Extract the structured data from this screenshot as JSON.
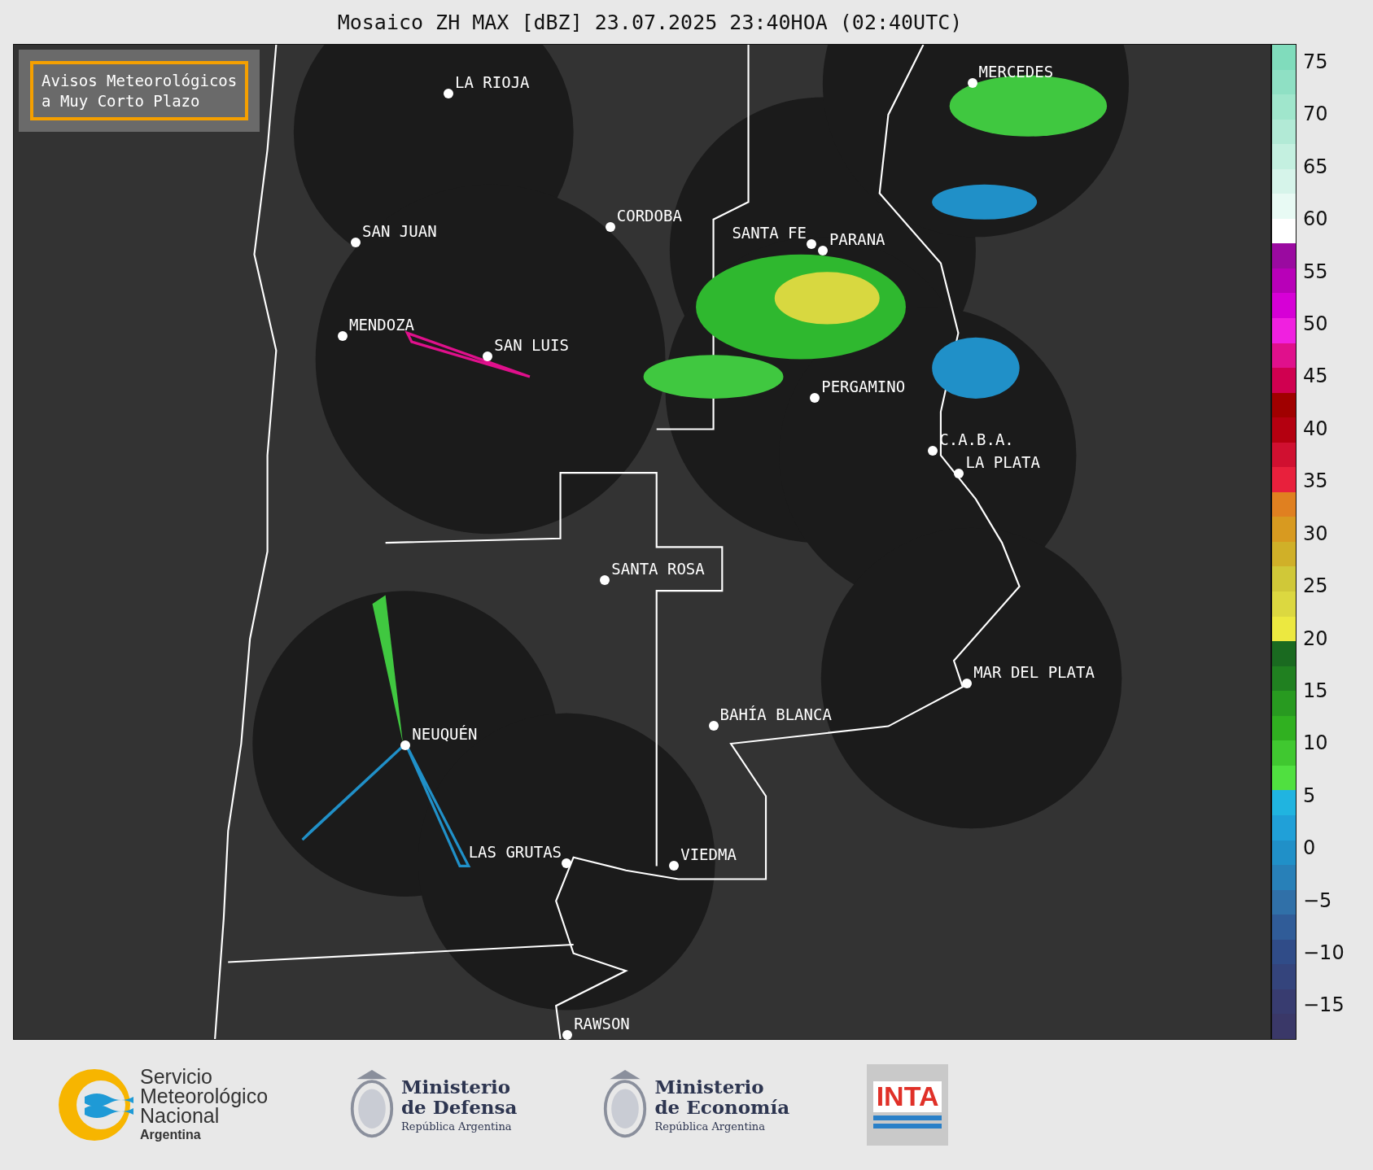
{
  "title": "Mosaico ZH MAX [dBZ] 23.07.2025 23:40HOA (02:40UTC)",
  "notice": "Avisos Meteorológicos\na Muy Corto Plazo",
  "cities": [
    "LA RIOJA",
    "SAN JUAN",
    "CORDOBA",
    "SANTA FE",
    "PARANA",
    "MENDOZA",
    "SAN LUIS",
    "MERCEDES",
    "PERGAMINO",
    "C.A.B.A.",
    "LA PLATA",
    "SANTA ROSA",
    "MAR DEL PLATA",
    "BAHÍA BLANCA",
    "NEUQUÉN",
    "LAS GRUTAS",
    "VIEDMA",
    "RAWSON"
  ],
  "colorbar": {
    "ticks": [
      "75",
      "70",
      "65",
      "60",
      "55",
      "50",
      "45",
      "40",
      "35",
      "30",
      "25",
      "20",
      "15",
      "10",
      "5",
      "0",
      "−5",
      "−10",
      "−15"
    ]
  },
  "logos": [
    {
      "kind": "smn",
      "lines": [
        "Servicio",
        "Meteorológico",
        "Nacional"
      ],
      "sub": "Argentina"
    },
    {
      "kind": "ministry",
      "lines": [
        "Ministerio",
        "de Defensa"
      ],
      "sub": "República Argentina"
    },
    {
      "kind": "ministry",
      "lines": [
        "Ministerio",
        "de Economía"
      ],
      "sub": "República Argentina"
    },
    {
      "kind": "inta",
      "lines": [
        "INTA"
      ]
    }
  ]
}
